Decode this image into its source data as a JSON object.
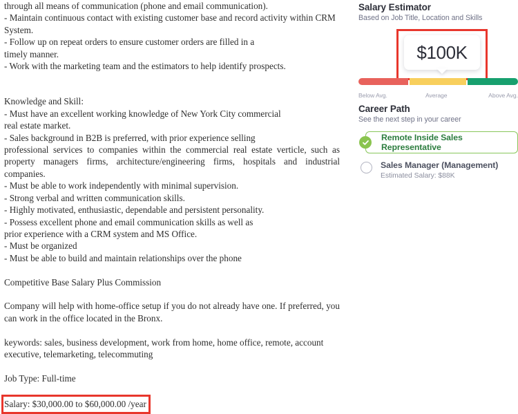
{
  "job_description": {
    "blocks": [
      {
        "type": "line",
        "text": "through all means of communication (phone and email communication)."
      },
      {
        "type": "line",
        "text": "- Maintain continuous contact with existing customer base and record activity within CRM System."
      },
      {
        "type": "line",
        "text": "- Follow up on repeat orders to ensure customer orders are filled in a"
      },
      {
        "type": "line",
        "text": "timely manner."
      },
      {
        "type": "line",
        "text": "- Work with the marketing team and the estimators to help identify prospects."
      },
      {
        "type": "gap-big"
      },
      {
        "type": "line",
        "text": "Knowledge and Skill:"
      },
      {
        "type": "line",
        "text": "- Must have an excellent working knowledge of New York City commercial"
      },
      {
        "type": "line",
        "text": "real estate market."
      },
      {
        "type": "line",
        "text": "- Sales background in B2B is preferred, with prior experience selling"
      },
      {
        "type": "justify",
        "text": "professional services to companies within the commercial real estate verticle, such as property managers firms, architecture/engineering firms, hospitals and industrial companies."
      },
      {
        "type": "line",
        "text": "- Must be able to work independently with minimal supervision."
      },
      {
        "type": "line",
        "text": "- Strong verbal and written communication skills."
      },
      {
        "type": "line",
        "text": "- Highly motivated, enthusiastic, dependable and persistent personality."
      },
      {
        "type": "line",
        "text": "- Possess excellent phone and email communication skills as well as"
      },
      {
        "type": "line",
        "text": "prior experience with a CRM system and MS Office."
      },
      {
        "type": "line",
        "text": "- Must be organized"
      },
      {
        "type": "line",
        "text": "- Must be able to build and maintain relationships over the phone"
      },
      {
        "type": "gap"
      },
      {
        "type": "line",
        "text": "Competitive Base Salary Plus Commission"
      },
      {
        "type": "gap"
      },
      {
        "type": "justify",
        "text": "Company will help with home-office setup if you do not already have one. If preferred, you can work in the office located in the Bronx."
      },
      {
        "type": "gap"
      },
      {
        "type": "line",
        "text": "keywords: sales, business development, work from home, home office, remote, account executive, telemarketing, telecommuting"
      },
      {
        "type": "gap"
      },
      {
        "type": "line",
        "text": "Job Type: Full-time"
      },
      {
        "type": "gap"
      }
    ],
    "salary_line": "Salary: $30,000.00 to $60,000.00 /year"
  },
  "salary_estimator": {
    "title": "Salary Estimator",
    "subtitle": "Based on Job Title, Location and Skills",
    "estimate": "$100K",
    "scale_labels": {
      "low": "Below Avg.",
      "mid": "Average",
      "high": "Above Avg."
    },
    "colors": {
      "below": "#e8625c",
      "average": "#f8cf5d",
      "above": "#17a06e",
      "annotation": "#e8362c"
    }
  },
  "career_path": {
    "title": "Career Path",
    "subtitle": "See the next step in your career",
    "options": [
      {
        "label": "Remote Inside Sales Representative",
        "selected": true,
        "icon": "check-circle-icon"
      },
      {
        "label": "Sales Manager (Management)",
        "selected": false,
        "icon": "radio-empty-icon",
        "estimated_salary": "Estimated Salary: $88K"
      }
    ]
  }
}
